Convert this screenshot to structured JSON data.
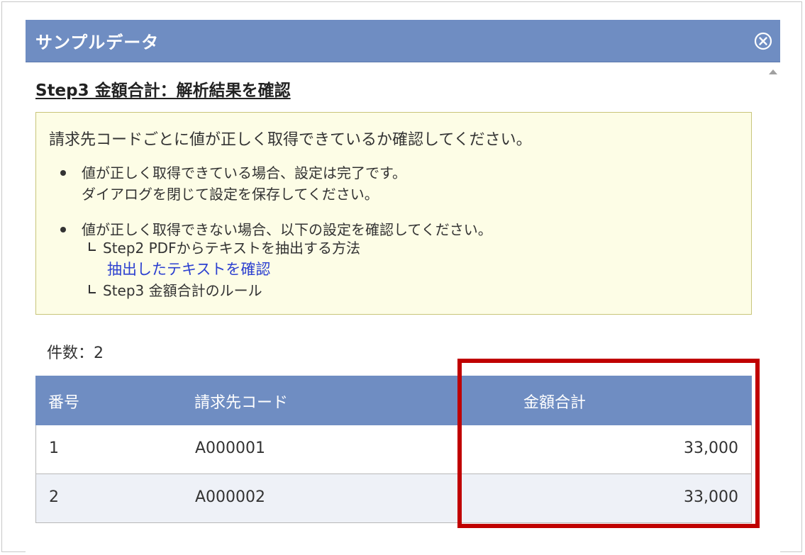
{
  "dialog": {
    "title": "サンプルデータ",
    "close_icon": "close-circle-icon"
  },
  "content": {
    "heading": "Step3 金額合計：解析結果を確認",
    "notice": {
      "lead": "請求先コードごとに値が正しく取得できているか確認してください。",
      "bullet1_line1": "値が正しく取得できている場合、設定は完了です。",
      "bullet1_line2": "ダイアログを閉じて設定を保存してください。",
      "bullet2_line1": "値が正しく取得できない場合、以下の設定を確認してください。",
      "sub1": "Step2 PDFからテキストを抽出する方法",
      "sub1_link": "抽出したテキストを確認",
      "sub2": "Step3 金額合計のルール"
    },
    "count_label": "件数：2"
  },
  "table": {
    "headers": [
      "番号",
      "請求先コード",
      "金額合計"
    ],
    "rows": [
      {
        "no": "1",
        "code": "A000001",
        "amount": "33,000"
      },
      {
        "no": "2",
        "code": "A000002",
        "amount": "33,000"
      }
    ]
  },
  "colors": {
    "header_bg": "#6f8dc2",
    "notice_bg": "#fdfde6",
    "highlight": "#c00000",
    "link": "#2c40d0"
  }
}
